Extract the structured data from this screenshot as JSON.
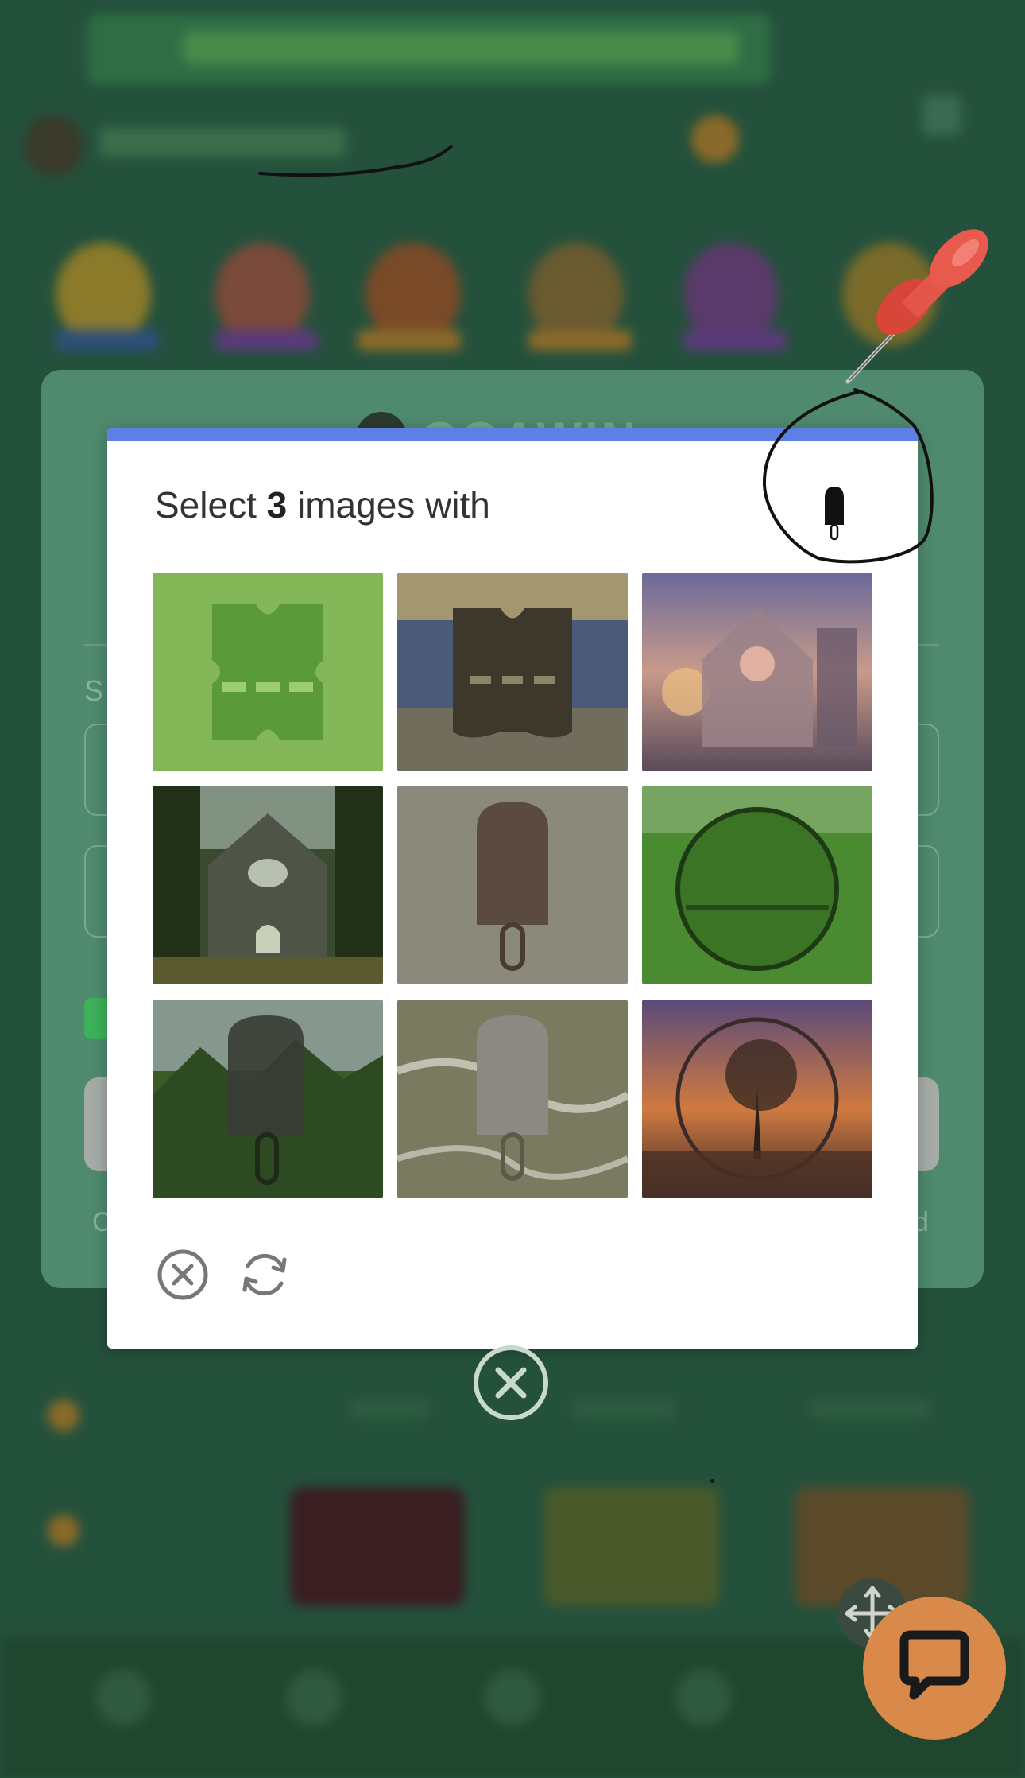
{
  "login": {
    "brand": "GGAWIN",
    "field_label": "S",
    "footer_left": "C",
    "footer_right": "d"
  },
  "captcha": {
    "prompt_prefix": "Select ",
    "prompt_count": "3",
    "prompt_suffix": " images with",
    "sample_icon": "popsicle-icon",
    "accent_color": "#5f7fe8",
    "tiles": [
      {
        "name": "ticket-grass"
      },
      {
        "name": "ticket-mosaic"
      },
      {
        "name": "church-sunset"
      },
      {
        "name": "church-jungle"
      },
      {
        "name": "popsicle-mosaic"
      },
      {
        "name": "circle-moss"
      },
      {
        "name": "popsicle-jungle"
      },
      {
        "name": "popsicle-river"
      },
      {
        "name": "circle-tree-sunset"
      }
    ],
    "footer": {
      "close_icon": "close-circle-icon",
      "refresh_icon": "refresh-icon"
    }
  },
  "overlays": {
    "dismiss_icon": "close-circle-icon",
    "pin_icon": "pushpin-icon",
    "move_icon": "move-arrows-icon",
    "chat_icon": "chat-bubble-icon",
    "chat_color": "#d98a4a"
  }
}
